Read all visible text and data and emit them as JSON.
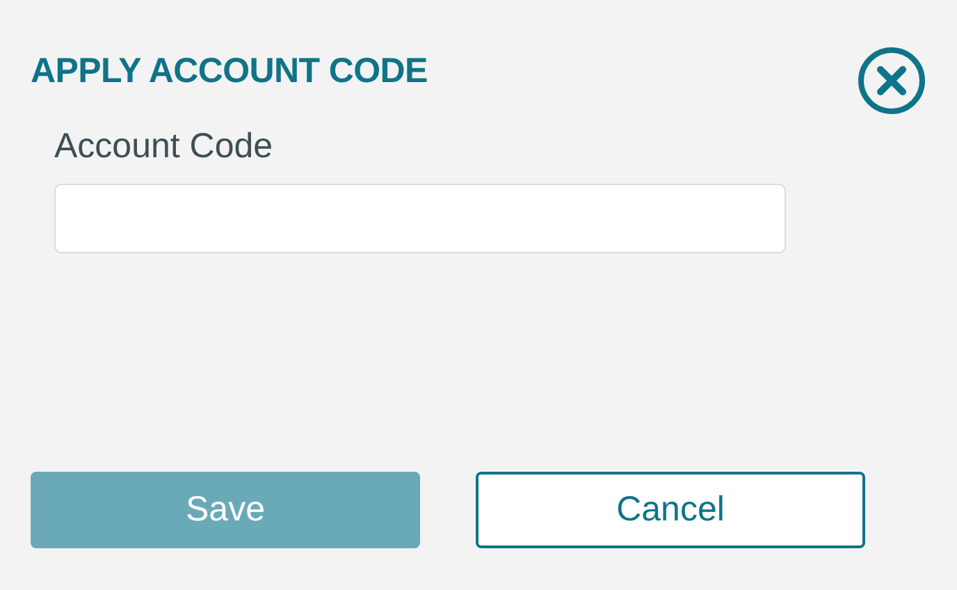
{
  "dialog": {
    "title": "APPLY ACCOUNT CODE"
  },
  "field": {
    "label": "Account Code"
  },
  "buttons": [
    {
      "label": "Save",
      "kind": "primary",
      "disabled": true
    },
    {
      "label": "Cancel",
      "kind": "secondary",
      "disabled": false
    }
  ]
}
